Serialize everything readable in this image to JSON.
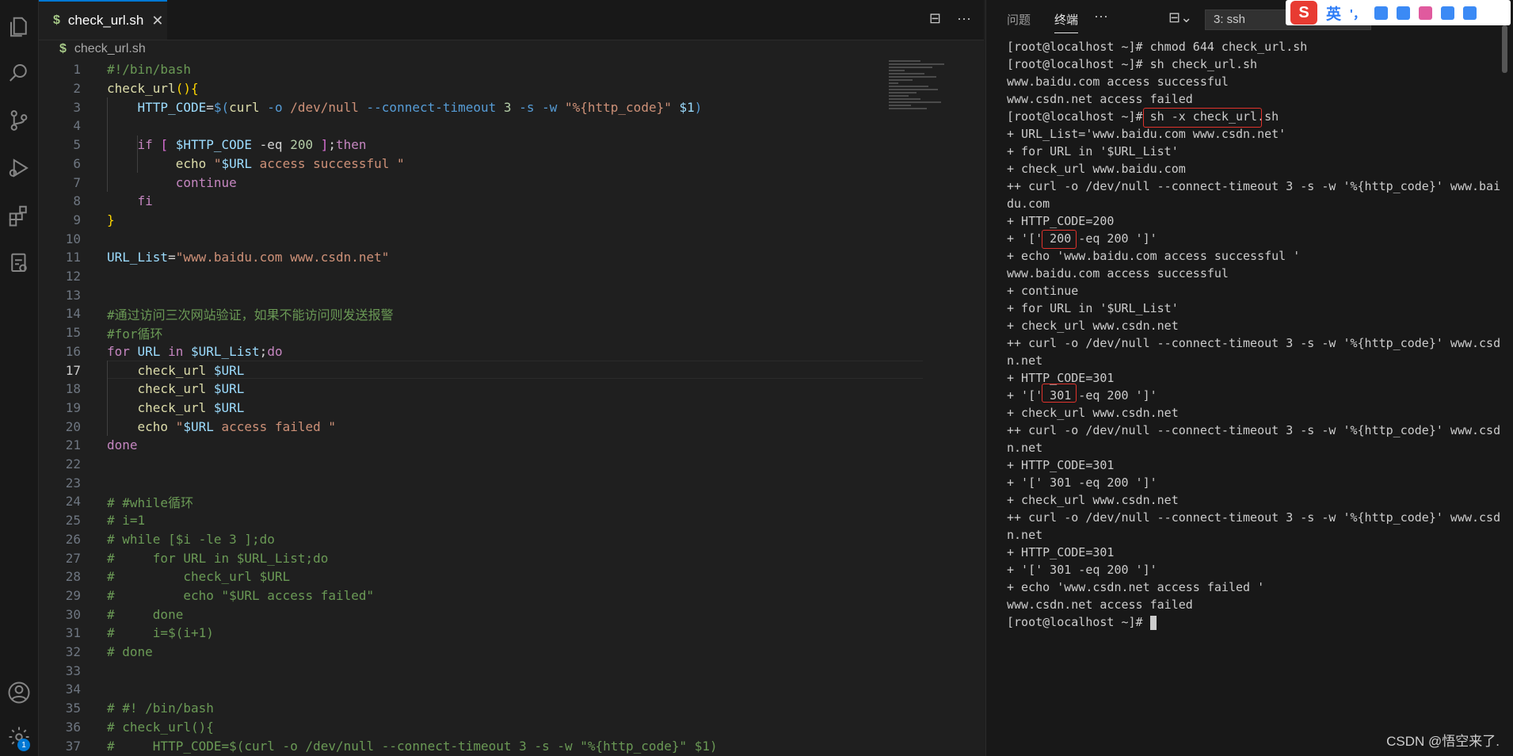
{
  "editor": {
    "tab_label": "check_url.sh",
    "tab_icon": "$",
    "breadcrumb": "check_url.sh",
    "current_line": 17,
    "lines": [
      [
        {
          "t": "#!/bin/bash",
          "c": "#6a9955"
        }
      ],
      [
        {
          "t": "check_url",
          "c": "#dcdcaa"
        },
        {
          "t": "(){",
          "c": "#ffd700"
        }
      ],
      [
        {
          "t": "    HTTP_CODE",
          "c": "#9cdcfe"
        },
        {
          "t": "=",
          "c": "#d4d4d4"
        },
        {
          "t": "$(",
          "c": "#569cd6"
        },
        {
          "t": "curl",
          "c": "#dcdcaa"
        },
        {
          "t": " -o ",
          "c": "#569cd6"
        },
        {
          "t": "/dev/null ",
          "c": "#ce9178"
        },
        {
          "t": "--connect-timeout ",
          "c": "#569cd6"
        },
        {
          "t": "3 ",
          "c": "#b5cea8"
        },
        {
          "t": "-s -w ",
          "c": "#569cd6"
        },
        {
          "t": "\"%{http_code}\"",
          "c": "#ce9178"
        },
        {
          "t": " $1",
          "c": "#9cdcfe"
        },
        {
          "t": ")",
          "c": "#569cd6"
        }
      ],
      [],
      [
        {
          "t": "    if ",
          "c": "#c586c0"
        },
        {
          "t": "[ ",
          "c": "#da70d6"
        },
        {
          "t": "$HTTP_CODE",
          "c": "#9cdcfe"
        },
        {
          "t": " -eq ",
          "c": "#d4d4d4"
        },
        {
          "t": "200",
          "c": "#b5cea8"
        },
        {
          "t": " ]",
          "c": "#da70d6"
        },
        {
          "t": ";",
          "c": "#d4d4d4"
        },
        {
          "t": "then",
          "c": "#c586c0"
        }
      ],
      [
        {
          "t": "         echo ",
          "c": "#dcdcaa"
        },
        {
          "t": "\"",
          "c": "#ce9178"
        },
        {
          "t": "$URL",
          "c": "#9cdcfe"
        },
        {
          "t": " access successful \"",
          "c": "#ce9178"
        }
      ],
      [
        {
          "t": "         continue",
          "c": "#c586c0"
        }
      ],
      [
        {
          "t": "    fi",
          "c": "#c586c0"
        }
      ],
      [
        {
          "t": "}",
          "c": "#ffd700"
        }
      ],
      [],
      [
        {
          "t": "URL_List",
          "c": "#9cdcfe"
        },
        {
          "t": "=",
          "c": "#d4d4d4"
        },
        {
          "t": "\"www.baidu.com www.csdn.net\"",
          "c": "#ce9178"
        }
      ],
      [],
      [],
      [
        {
          "t": "#通过访问三次网站验证，如果不能访问则发送报警",
          "c": "#6a9955"
        }
      ],
      [
        {
          "t": "#for循环",
          "c": "#6a9955"
        }
      ],
      [
        {
          "t": "for ",
          "c": "#c586c0"
        },
        {
          "t": "URL",
          "c": "#9cdcfe"
        },
        {
          "t": " in ",
          "c": "#c586c0"
        },
        {
          "t": "$URL_List",
          "c": "#9cdcfe"
        },
        {
          "t": ";",
          "c": "#d4d4d4"
        },
        {
          "t": "do",
          "c": "#c586c0"
        }
      ],
      [
        {
          "t": "    check_url ",
          "c": "#dcdcaa"
        },
        {
          "t": "$URL",
          "c": "#9cdcfe"
        }
      ],
      [
        {
          "t": "    check_url ",
          "c": "#dcdcaa"
        },
        {
          "t": "$URL",
          "c": "#9cdcfe"
        }
      ],
      [
        {
          "t": "    check_url ",
          "c": "#dcdcaa"
        },
        {
          "t": "$URL",
          "c": "#9cdcfe"
        }
      ],
      [
        {
          "t": "    echo ",
          "c": "#dcdcaa"
        },
        {
          "t": "\"",
          "c": "#ce9178"
        },
        {
          "t": "$URL",
          "c": "#9cdcfe"
        },
        {
          "t": " access failed \"",
          "c": "#ce9178"
        }
      ],
      [
        {
          "t": "done",
          "c": "#c586c0"
        }
      ],
      [],
      [],
      [
        {
          "t": "# #while循环",
          "c": "#6a9955"
        }
      ],
      [
        {
          "t": "# i=1",
          "c": "#6a9955"
        }
      ],
      [
        {
          "t": "# while [$i -le 3 ];do",
          "c": "#6a9955"
        }
      ],
      [
        {
          "t": "#     for URL in $URL_List;do",
          "c": "#6a9955"
        }
      ],
      [
        {
          "t": "#         check_url $URL",
          "c": "#6a9955"
        }
      ],
      [
        {
          "t": "#         echo \"$URL access failed\"",
          "c": "#6a9955"
        }
      ],
      [
        {
          "t": "#     done",
          "c": "#6a9955"
        }
      ],
      [
        {
          "t": "#     i=$(i+1)",
          "c": "#6a9955"
        }
      ],
      [
        {
          "t": "# done",
          "c": "#6a9955"
        }
      ],
      [],
      [],
      [
        {
          "t": "# #! /bin/bash",
          "c": "#6a9955"
        }
      ],
      [
        {
          "t": "# check_url(){",
          "c": "#6a9955"
        }
      ],
      [
        {
          "t": "#     HTTP_CODE=$(curl -o /dev/null --connect-timeout 3 -s -w \"%{http_code}\" $1)",
          "c": "#6a9955"
        }
      ]
    ]
  },
  "panel": {
    "tabs": [
      "问题",
      "终端"
    ],
    "active_tab": "终端",
    "more": "···",
    "terminal_select": "3: ssh",
    "ime_label": "英",
    "ime_punct": "'，"
  },
  "terminal": {
    "lines": [
      "[root@localhost ~]# chmod 644 check_url.sh",
      "[root@localhost ~]# sh check_url.sh",
      "www.baidu.com access successful",
      "www.csdn.net access failed",
      "[root@localhost ~]# sh -x check_url.sh",
      "+ URL_List='www.baidu.com www.csdn.net'",
      "+ for URL in '$URL_List'",
      "+ check_url www.baidu.com",
      "++ curl -o /dev/null --connect-timeout 3 -s -w '%{http_code}' www.bai",
      "du.com",
      "+ HTTP_CODE=200",
      "+ '[' 200 -eq 200 ']'",
      "+ echo 'www.baidu.com access successful '",
      "www.baidu.com access successful",
      "+ continue",
      "+ for URL in '$URL_List'",
      "+ check_url www.csdn.net",
      "++ curl -o /dev/null --connect-timeout 3 -s -w '%{http_code}' www.csd",
      "n.net",
      "+ HTTP_CODE=301",
      "+ '[' 301 -eq 200 ']'",
      "+ check_url www.csdn.net",
      "++ curl -o /dev/null --connect-timeout 3 -s -w '%{http_code}' www.csd",
      "n.net",
      "+ HTTP_CODE=301",
      "+ '[' 301 -eq 200 ']'",
      "+ check_url www.csdn.net",
      "++ curl -o /dev/null --connect-timeout 3 -s -w '%{http_code}' www.csd",
      "n.net",
      "+ HTTP_CODE=301",
      "+ '[' 301 -eq 200 ']'",
      "+ echo 'www.csdn.net access failed '",
      "www.csdn.net access failed",
      "[root@localhost ~]# "
    ]
  },
  "activity": {
    "items": [
      "explorer-icon",
      "search-icon",
      "source-control-icon",
      "run-debug-icon",
      "extensions-icon",
      "remote-explorer-icon"
    ],
    "bottom": [
      "account-icon",
      "settings-icon"
    ],
    "settings_badge": "1"
  },
  "watermark": "CSDN @悟空来了."
}
